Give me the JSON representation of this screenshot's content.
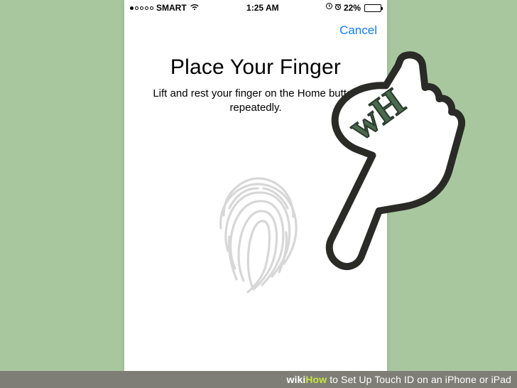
{
  "status": {
    "carrier": "SMART",
    "time": "1:25 AM",
    "battery_percent": "22%"
  },
  "nav": {
    "cancel": "Cancel"
  },
  "screen": {
    "title": "Place Your Finger",
    "subtitle": "Lift and rest your finger on the Home button repeatedly."
  },
  "caption": {
    "wiki": "wiki",
    "how": "How",
    "rest": " to Set Up Touch ID on an iPhone or iPad"
  },
  "watermark": "wH"
}
